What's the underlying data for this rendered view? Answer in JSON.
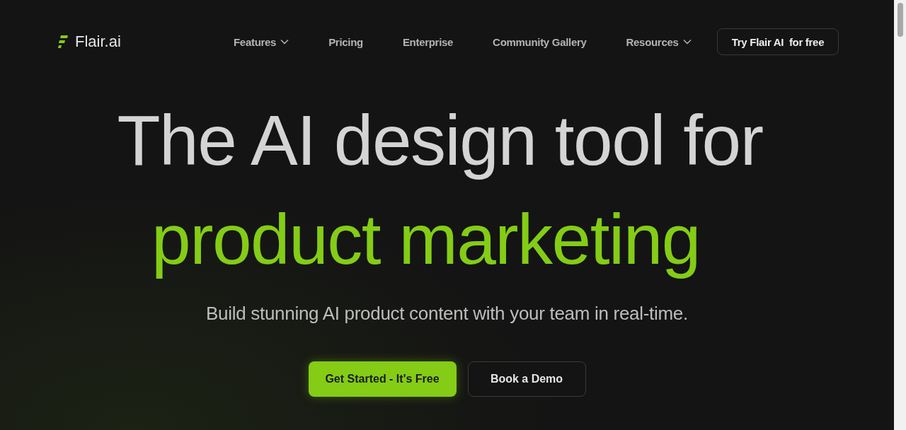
{
  "brand": {
    "name": "Flair.ai"
  },
  "nav": [
    {
      "label": "Features",
      "dropdown": true
    },
    {
      "label": "Pricing",
      "dropdown": false
    },
    {
      "label": "Enterprise",
      "dropdown": false
    },
    {
      "label": "Community Gallery",
      "dropdown": false
    },
    {
      "label": "Resources",
      "dropdown": true
    }
  ],
  "nav_cta": "Try Flair AI  for free",
  "hero": {
    "line_1": "The AI design tool for",
    "line_2": "product marketing",
    "subtitle": "Build stunning AI product content with your team in real-time.",
    "buttons": [
      {
        "label": "Get Started - It's Free",
        "kind": "primary"
      },
      {
        "label": "Book a Demo",
        "kind": "secondary"
      }
    ]
  }
}
